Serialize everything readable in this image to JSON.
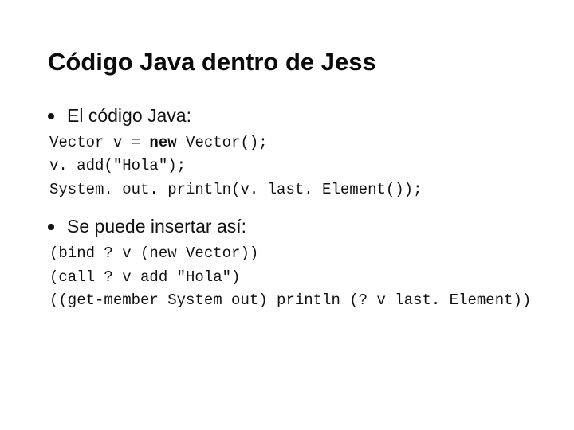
{
  "title": "Código Java dentro de Jess",
  "bullets": {
    "b1": "El código Java:",
    "b2": "Se puede insertar así:"
  },
  "code1": {
    "l1a": "Vector v = ",
    "l1b": "new",
    "l1c": " Vector();",
    "l2": "v. add(\"Hola\");",
    "l3": "System. out. println(v. last. Element());"
  },
  "code2": {
    "l1": "(bind ? v (new Vector))",
    "l2": "(call ? v add \"Hola\")",
    "l3": "((get-member System out) println (? v last. Element))"
  }
}
